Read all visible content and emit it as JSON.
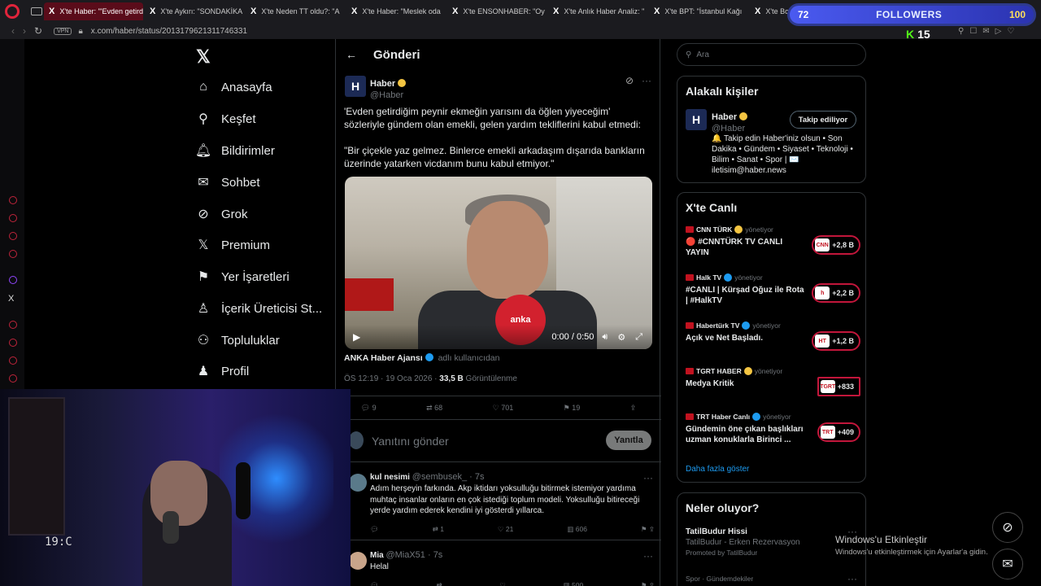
{
  "browser": {
    "tabs": [
      {
        "label": "X'te Haber: \"'Evden getird"
      },
      {
        "label": "X'te Aykırı: \"SONDAKİKA"
      },
      {
        "label": "X'te Neden TT oldu?: \"A"
      },
      {
        "label": "X'te Haber: \"Meslek oda"
      },
      {
        "label": "X'te ENSONHABER: \"Oy"
      },
      {
        "label": "X'te Anlık Haber Analiz: \""
      },
      {
        "label": "X'te BPT: \"İstanbul Kağı"
      },
      {
        "label": "X'te Bo"
      }
    ],
    "vpn": "VPN",
    "url": "x.com/haber/status/2013179621311746331"
  },
  "overlay": {
    "count": "72",
    "label": "FOLLOWERS",
    "goal": "100",
    "kick_logo": "K",
    "kick_count": "15"
  },
  "nav": {
    "items": [
      {
        "label": "Anasayfa"
      },
      {
        "label": "Keşfet"
      },
      {
        "label": "Bildirimler"
      },
      {
        "label": "Sohbet"
      },
      {
        "label": "Grok"
      },
      {
        "label": "Premium"
      },
      {
        "label": "Yer İşaretleri"
      },
      {
        "label": "İçerik Üreticisi St..."
      },
      {
        "label": "Topluluklar"
      },
      {
        "label": "Profil"
      }
    ]
  },
  "post": {
    "header": "Gönderi",
    "author": "Haber",
    "handle": "@Haber",
    "avatar_letter": "H",
    "text1": "'Evden getirdiğim peynir ekmeğin yarısını da öğlen yiyeceğim' sözleriyle gündem olan emekli, gelen yardım tekliflerini kabul etmedi:",
    "text2": "\"Bir çiçekle yaz gelmez. Binlerce emekli arkadaşım dışarıda bankların üzerinde yatarken vicdanım bunu kabul etmiyor.\"",
    "video_time": "0:00 / 0:50",
    "mic_label": "anka",
    "source_name": "ANKA Haber Ajansı",
    "source_suffix": "adlı kullanıcıdan",
    "time": "ÖS 12:19 · 19 Oca 2026 ·",
    "views": "33,5 B",
    "views_label": "Görüntülenme",
    "stats": {
      "replies": "9",
      "reposts": "68",
      "likes": "701",
      "bookmarks": "19"
    }
  },
  "reply": {
    "placeholder": "Yanıtını gönder",
    "button": "Yanıtla"
  },
  "comments": [
    {
      "name": "kul nesimi",
      "handle": "@sembusek_ · 7s",
      "text": "Adım herşeyin farkında. Akp iktidarı yoksulluğu bitirmek istemiyor yardıma muhtaç insanlar onların en çok istediği toplum modeli. Yoksulluğu bitireceği yerde yardım ederek kendini iyi gösterdi yıllarca.",
      "replies": "",
      "reposts": "1",
      "likes": "21",
      "views": "606"
    },
    {
      "name": "Mia",
      "handle": "@MiaX51 · 7s",
      "text": "Helal",
      "replies": "",
      "reposts": "",
      "likes": "",
      "views": "500"
    }
  ],
  "right": {
    "search_placeholder": "Ara",
    "related_title": "Alakalı kişiler",
    "related": {
      "name": "Haber",
      "handle": "@Haber",
      "button": "Takip ediliyor",
      "bio": "🔔 Takip edin Haber'iniz olsun • Son Dakika • Gündem • Siyaset • Teknoloji • Bilim • Sanat • Spor | ✉️ iletisim@haber.news"
    },
    "live_title": "X'te Canlı",
    "live": [
      {
        "channel": "CNN TÜRK",
        "by": "yönetiyor",
        "title": "🔴 #CNNTÜRK TV CANLI YAYIN",
        "count": "+2,8 B",
        "logo": "CNN"
      },
      {
        "channel": "Halk TV",
        "by": "yönetiyor",
        "title": "#CANLI | Kürşad Oğuz ile Rota | #HalkTV",
        "count": "+2,2 B",
        "logo": "h"
      },
      {
        "channel": "Habertürk TV",
        "by": "yönetiyor",
        "title": "Açık ve Net Başladı.",
        "count": "+1,2 B",
        "logo": "HT"
      },
      {
        "channel": "TGRT HABER",
        "by": "yönetiyor",
        "title": "Medya Kritik",
        "count": "+833",
        "logo": "TGRT"
      },
      {
        "channel": "TRT Haber Canlı",
        "by": "yönetiyor",
        "title": "Gündemin öne çıkan başlıkları uzman konuklarla Birinci ...",
        "count": "+409",
        "logo": "TRT"
      }
    ],
    "more": "Daha fazla göster",
    "trends_title": "Neler oluyor?",
    "trend1": {
      "title": "TatilBudur Hissi",
      "sub": "TatilBudur - Erken Rezervasyon",
      "promo": "Promoted by TatilBudur"
    },
    "trend2": {
      "title": "Spor · Gündemdekiler"
    }
  },
  "windows": {
    "line1": "Windows'u Etkinleştir",
    "line2": "Windows'u etkinleştirmek için Ayarlar'a gidin."
  },
  "cam": {
    "clock": "19:C"
  }
}
